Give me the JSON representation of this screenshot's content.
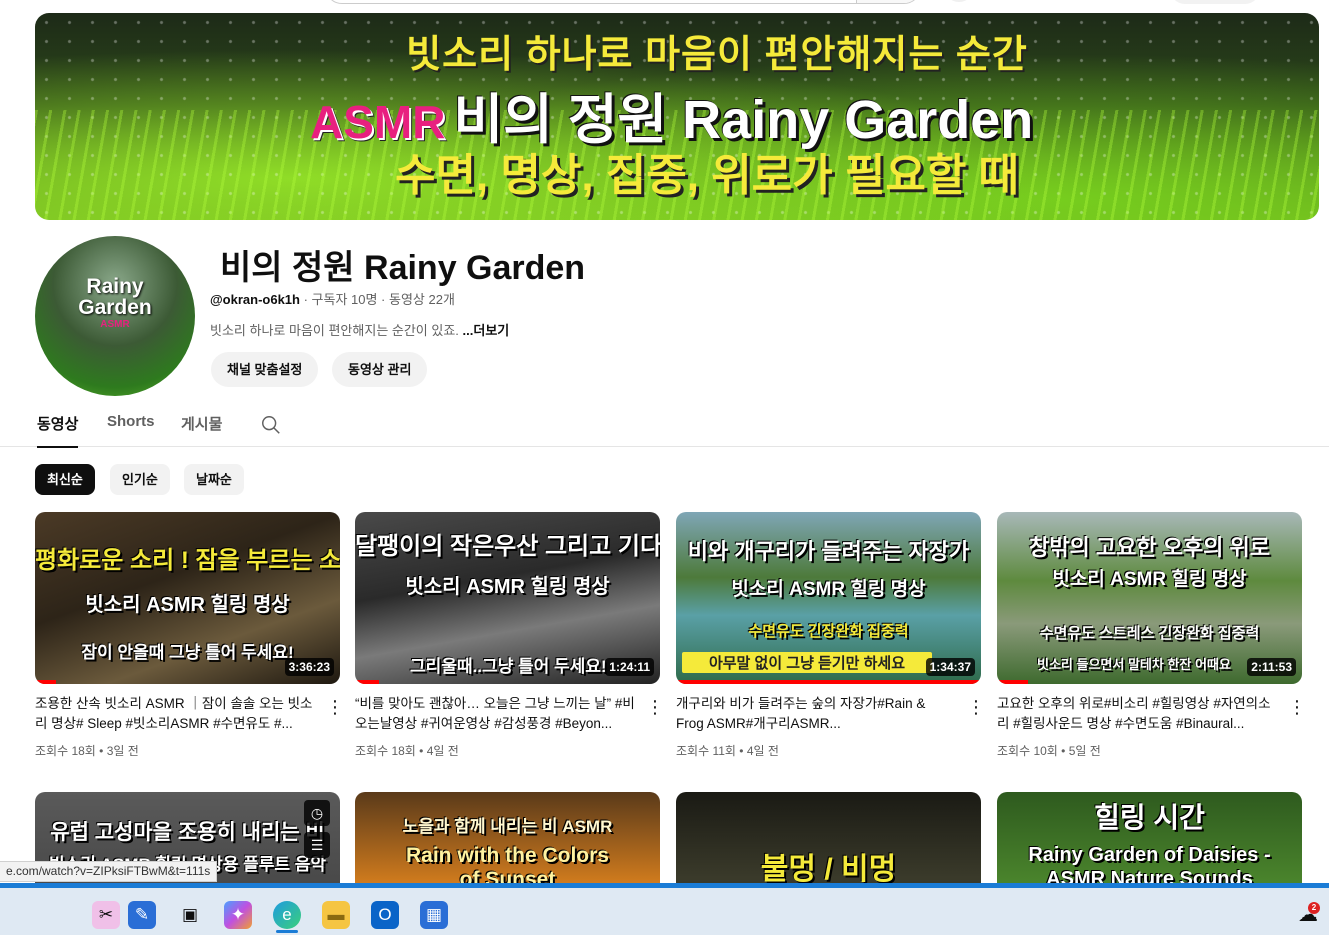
{
  "banner": {
    "line1": "빗소리 하나로 마음이 편안해지는 순간",
    "asmr": "ASMR",
    "line2": "비의 정원 Rainy Garden",
    "line3": "수면, 명상, 집중, 위로가 필요할 때"
  },
  "avatar": {
    "line1": "Rainy",
    "line2": "Garden",
    "line3": "ASMR"
  },
  "channel": {
    "title": "비의 정원 Rainy Garden",
    "handle": "@okran-o6k1h",
    "meta_rest": " · 구독자 10명 · 동영상 22개",
    "description": "빗소리 하나로 마음이 편안해지는 순간이 있죠.",
    "more": " ...더보기",
    "customize_label": "채널 맞춤설정",
    "manage_label": "동영상 관리"
  },
  "tabs": {
    "videos": "동영상",
    "shorts": "Shorts",
    "posts": "게시물"
  },
  "chips": {
    "latest": "최신순",
    "popular": "인기순",
    "date": "날짜순"
  },
  "videos": [
    {
      "thumb_top": "평화로운 소리 ! 잠을 부르는 소리",
      "thumb_mid": "빗소리 ASMR 힐링 명상",
      "thumb_bottom": "잠이 안올때 그냥 틀어 두세요!",
      "duration": "3:36:23",
      "progress": 0.07,
      "title": "조용한 산속 빗소리 ASMR ｜잠이 솔솔 오는 빗소리 명상# Sleep #빗소리ASMR #수면유도 #...",
      "meta": "조회수 18회 • 3일 전"
    },
    {
      "thumb_top": "달팽이의 작은우산 그리고 기다림",
      "thumb_mid": "빗소리 ASMR 힐링 명상",
      "thumb_bottom": "그리울때..그냥 틀어 두세요!",
      "duration": "1:24:11",
      "progress": 0.08,
      "title": "“비를 맞아도 괜찮아… 오늘은 그냥 느끼는 날” #비오는날영상 #귀여운영상 #감성풍경 #Beyon...",
      "meta": "조회수 18회 • 4일 전"
    },
    {
      "thumb_top": "비와 개구리가 들려주는 자장가",
      "thumb_mid": "빗소리 ASMR 힐링 명상",
      "thumb_bottom": "수면유도 긴장완화 집중력",
      "thumb_bottom2": "아무말 없이 그냥 듣기만 하세요",
      "duration": "1:34:37",
      "progress": 1.0,
      "title": "개구리와 비가 들려주는 숲의 자장가#Rain & Frog ASMR#개구리ASMR...",
      "meta": "조회수 11회 • 4일 전"
    },
    {
      "thumb_top": "창밖의 고요한 오후의 위로",
      "thumb_mid": "빗소리 ASMR 힐링 명상",
      "thumb_bottom": "수면유도 스트레스 긴장완화 집중력",
      "thumb_bottom2": "빗소리 들으면서 말테차 한잔 어때요",
      "duration": "2:11:53",
      "progress": 0.1,
      "title": "고요한 오후의 위로#비소리 #힐링영상 #자연의소리 #힐링사운드 명상 #수면도움 #Binaural...",
      "meta": "조회수 10회 • 5일 전"
    },
    {
      "thumb_top": "유럽 고성마을 조용히 내리는 비",
      "thumb_mid": "빗소리 ASMR 힐링 명상용 플루트 음악"
    },
    {
      "thumb_top": "노을과 함께 내리는 비 ASMR",
      "thumb_mid": "Rain with the Colors",
      "thumb_mid2": "of Sunset"
    },
    {
      "thumb_top": "불멍 / 비멍"
    },
    {
      "thumb_top": "힐링 시간",
      "thumb_mid": "Rainy Garden of Daisies -",
      "thumb_mid2": "ASMR Nature Sounds"
    }
  ],
  "status_url": "e.com/watch?v=ZIPksiFTBwM&t=111s",
  "taskbar": {
    "notification_count": "2"
  }
}
